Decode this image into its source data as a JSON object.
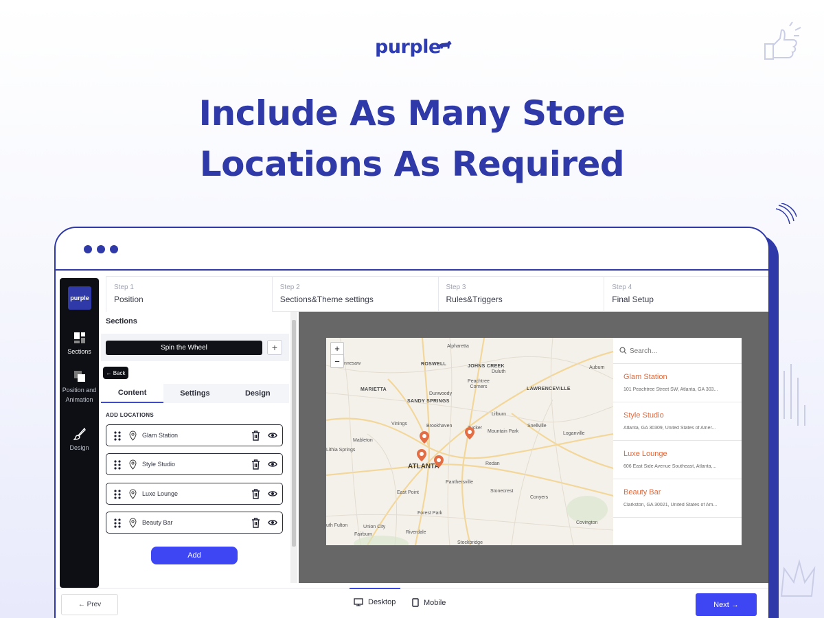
{
  "brand": {
    "logo_text": "purple",
    "color": "#2f3aa8",
    "accent": "#3d46f2"
  },
  "hero": {
    "line1": "Include As Many Store",
    "line2": "Locations As Required"
  },
  "rail": {
    "logo_text": "purple",
    "items": [
      {
        "label": "Sections",
        "icon": "sections-icon"
      },
      {
        "label": "Position and Animation",
        "icon": "position-icon"
      },
      {
        "label": "Design",
        "icon": "brush-icon"
      }
    ]
  },
  "steps": [
    {
      "num": "Step 1",
      "label": "Position"
    },
    {
      "num": "Step 2",
      "label": "Sections&Theme settings"
    },
    {
      "num": "Step 3",
      "label": "Rules&Triggers"
    },
    {
      "num": "Step 4",
      "label": "Final Setup"
    }
  ],
  "panel": {
    "title": "Sections",
    "section_button": "Spin the Wheel",
    "add_symbol": "+",
    "back_label": "← Back",
    "tabs": [
      "Content",
      "Settings",
      "Design"
    ],
    "add_locations_label": "ADD LOCATIONS",
    "locations": [
      "Glam Station",
      "Style Studio",
      "Luxe Lounge",
      "Beauty Bar"
    ],
    "add_button": "Add"
  },
  "map": {
    "zoom_in": "+",
    "zoom_out": "−",
    "labels": {
      "alpharetta": "Alpharetta",
      "roswell": "ROSWELL",
      "johns_creek": "JOHNS CREEK",
      "duluth": "Duluth",
      "auburn": "Auburn",
      "nnesaw": "nnesaw",
      "dunwoody": "Dunwoody",
      "peachtree": "Peachtree Corners",
      "marietta": "MARIETTA",
      "lawrenceville": "LAWRENCEVILLE",
      "sandy_springs": "SANDY SPRINGS",
      "vinings": "Vinings",
      "brookhaven": "Brookhaven",
      "lilburn": "Lilburn",
      "tucker": "Tucker",
      "mountain_park": "Mountain Park",
      "snellville": "Snellville",
      "loganville": "Loganville",
      "mableton": "Mableton",
      "lithia": "Lithia Springs",
      "atlanta": "ATLANTA",
      "redan": "Redan",
      "panthersville": "Panthersville",
      "east_point": "East Point",
      "stonecrest": "Stonecrest",
      "conyers": "Conyers",
      "forest_park": "Forest Park",
      "covington": "Covington",
      "south_fulton": "uth Fulton",
      "union_city": "Union City",
      "riverdale": "Riverdale",
      "fairburn": "Fairburn",
      "stockbridge": "Stockbridge"
    }
  },
  "store_list": {
    "search_placeholder": "Search...",
    "stores": [
      {
        "name": "Glam Station",
        "address": "101 Peachtree Street SW, Atlanta, GA 303..."
      },
      {
        "name": "Style Studio",
        "address": "Atlanta, GA 30309, United States of Amer..."
      },
      {
        "name": "Luxe Lounge",
        "address": "606 East Side Avenue Southeast, Atlanta,..."
      },
      {
        "name": "Beauty Bar",
        "address": "Clarkston, GA 30021, United States of Am..."
      }
    ]
  },
  "bottom": {
    "prev": "← Prev",
    "desktop": "Desktop",
    "mobile": "Mobile",
    "next": "Next →"
  }
}
